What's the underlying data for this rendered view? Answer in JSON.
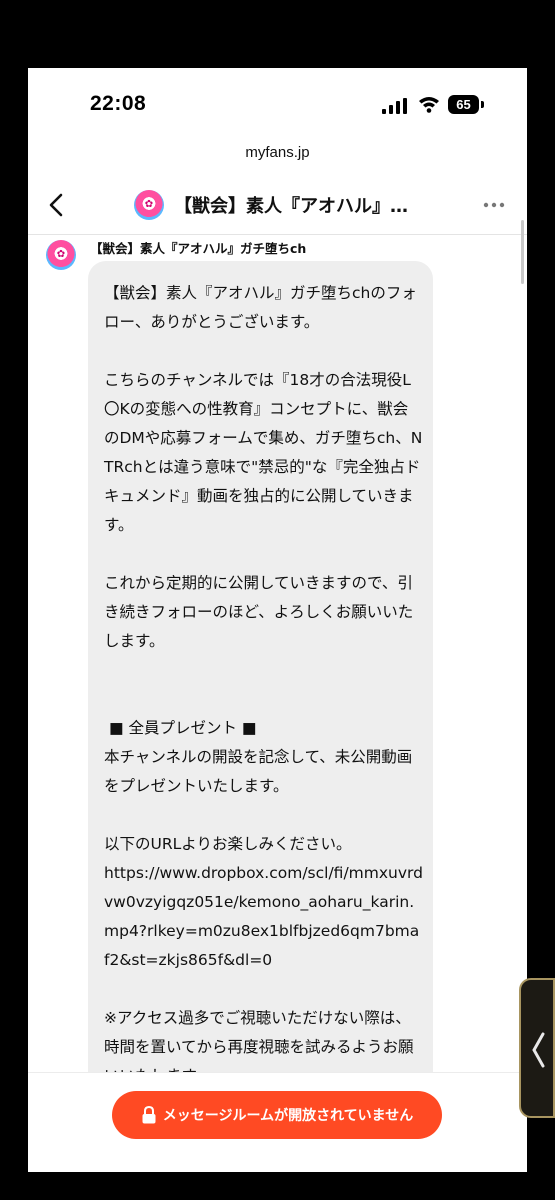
{
  "status_bar": {
    "time": "22:08",
    "battery": "65"
  },
  "browser": {
    "url": "myfans.jp"
  },
  "header": {
    "back_icon": "chevron-left-icon",
    "title": "【獣会】素人『アオハル』…",
    "more_icon": "more-horizontal-icon"
  },
  "message": {
    "sender": "【獣会】素人『アオハル』ガチ堕ちch",
    "text": "【獣会】素人『アオハル』ガチ堕ちchのフォロー、ありがとうございます。\n\nこちらのチャンネルでは『18才の合法現役L〇Kの変態への性教育』コンセプトに、獣会のDMや応募フォームで集め、ガチ堕ちch、NTRchとは違う意味で\"禁忌的\"な『完全独占ドキュメンド』動画を独占的に公開していきます。\n\nこれから定期的に公開していきますので、引き続きフォローのほど、よろしくお願いいたします。\n\n\n ■ 全員プレゼント ■\n本チャンネルの開設を記念して、未公開動画をプレゼントいたします。\n\n以下のURLよりお楽しみください。\nhttps://www.dropbox.com/scl/fi/mmxuvrdvw0vzyigqz051e/kemono_aoharu_karin.mp4?rlkey=m0zu8ex1blfbjzed6qm7bmaf2&st=zkjs865f&dl=0\n\n※アクセス過多でご視聴いただけない際は、時間を置いてから再度視聴を試みるようお願いいたします。"
  },
  "footer": {
    "button_label": "メッセージルームが開放されていません",
    "button_icon": "lock-icon",
    "button_color": "#ff4a23"
  }
}
